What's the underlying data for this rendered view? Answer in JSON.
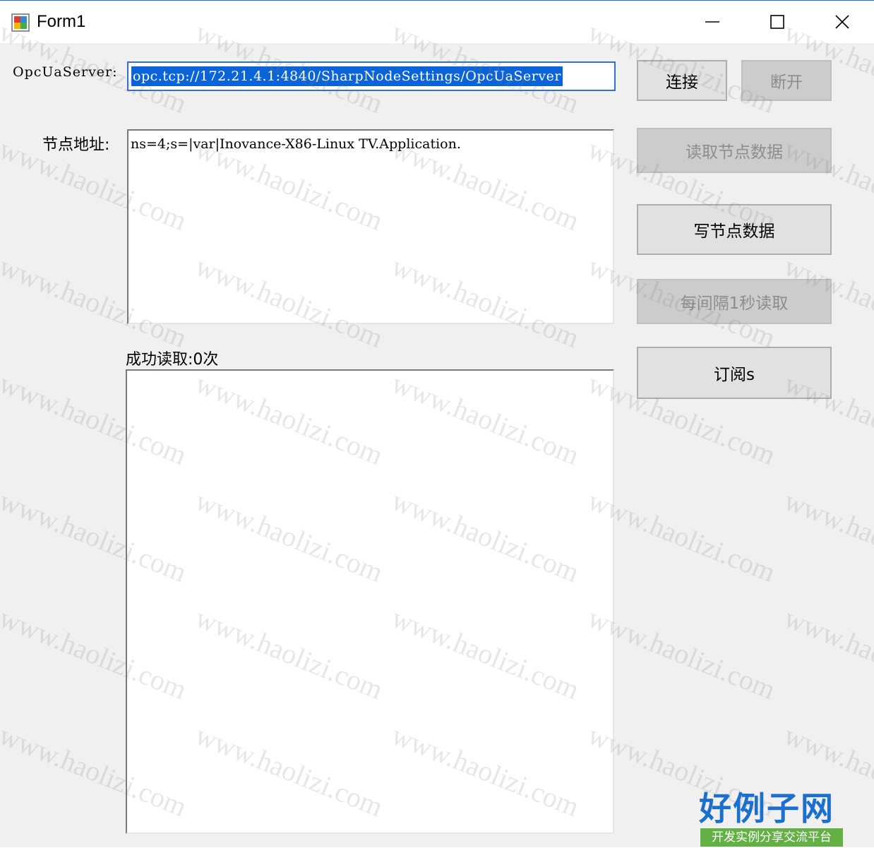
{
  "window": {
    "title": "Form1"
  },
  "server": {
    "label": "OpcUaServer:",
    "url": "opc.tcp://172.21.4.1:4840/SharpNodeSettings/OpcUaServer"
  },
  "node": {
    "label": "节点地址:",
    "address": "ns=4;s=|var|Inovance-X86-Linux TV.Application."
  },
  "status": {
    "read_count_text": "成功读取:0次"
  },
  "buttons": {
    "connect": "连接",
    "disconnect": "断开",
    "read_node": "读取节点数据",
    "write_node": "写节点数据",
    "read_interval": "每间隔1秒读取",
    "subscribe": "订阅s"
  },
  "watermark": "www.haolizi.com",
  "logo": {
    "main": "好例子网",
    "tagline": "开发实例分享交流平台"
  },
  "colors": {
    "selection": "#0a64d8",
    "focus_border": "#2f6fd6",
    "disabled_text": "#8d8d8d",
    "logo_blue": "#1a6fcf",
    "logo_green": "#63b045"
  }
}
